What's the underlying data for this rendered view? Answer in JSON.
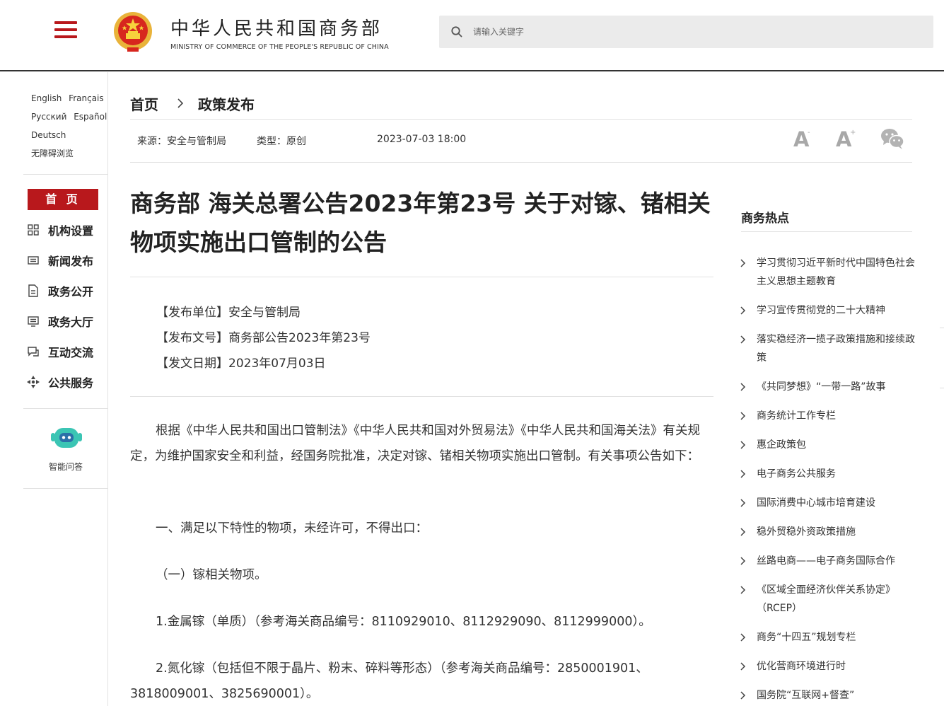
{
  "header": {
    "site_name_cn": "中华人民共和国商务部",
    "site_name_en": "MINISTRY OF COMMERCE OF THE PEOPLE'S REPUBLIC OF CHINA",
    "search_placeholder": "请输入关键字"
  },
  "sidebar": {
    "languages": [
      "English",
      "Français",
      "Русский",
      "Español",
      "Deutsch"
    ],
    "accessibility": "无障碍浏览",
    "nav_home": "首 页",
    "nav_items": [
      {
        "label": "机构设置",
        "icon": "org-grid-icon"
      },
      {
        "label": "新闻发布",
        "icon": "news-icon"
      },
      {
        "label": "政务公开",
        "icon": "document-icon"
      },
      {
        "label": "政务大厅",
        "icon": "service-hall-icon"
      },
      {
        "label": "互动交流",
        "icon": "chat-icon"
      },
      {
        "label": "公共服务",
        "icon": "public-service-icon"
      }
    ],
    "assistant_label": "智能问答"
  },
  "breadcrumb": {
    "home": "首页",
    "current": "政策发布"
  },
  "meta": {
    "source": "来源：安全与管制局",
    "type": "类型：原创",
    "datetime": "2023-07-03 18:00"
  },
  "tools": {
    "font_smaller": "A",
    "font_smaller_mark": "-",
    "font_larger": "A",
    "font_larger_mark": "+"
  },
  "article": {
    "title": "商务部 海关总署公告2023年第23号 关于对镓、锗相关物项实施出口管制的公告",
    "pub_unit": "【发布单位】安全与管制局",
    "pub_number": "【发布文号】商务部公告2023年第23号",
    "pub_date": "【发文日期】2023年07月03日",
    "para1": "根据《中华人民共和国出口管制法》《中华人民共和国对外贸易法》《中华人民共和国海关法》有关规定，为维护国家安全和利益，经国务院批准，决定对镓、锗相关物项实施出口管制。有关事项公告如下：",
    "para2": "一、满足以下特性的物项，未经许可，不得出口：",
    "para3": "（一）镓相关物项。",
    "para4": "1.金属镓（单质）（参考海关商品编号：8110929010、8112929090、8112999000）。",
    "para5": "2.氮化镓（包括但不限于晶片、粉末、碎料等形态）（参考海关商品编号：2850001901、3818009001、3825690001）。"
  },
  "hot": {
    "title": "商务热点",
    "items": [
      "学习贯彻习近平新时代中国特色社会主义思想主题教育",
      "学习宣传贯彻党的二十大精神",
      "落实稳经济一揽子政策措施和接续政策",
      "《共同梦想》“一带一路”故事",
      "商务统计工作专栏",
      "惠企政策包",
      "电子商务公共服务",
      "国际消费中心城市培育建设",
      "稳外贸稳外资政策措施",
      "丝路电商——电子商务国际合作",
      "《区域全面经济伙伴关系协定》（RCEP）",
      "商务“十四五”规划专栏",
      "优化营商环境进行时",
      "国务院“互联网+督查”"
    ]
  },
  "colors": {
    "brand_red": "#b8181c",
    "assistant_teal": "#3bc5b4"
  }
}
